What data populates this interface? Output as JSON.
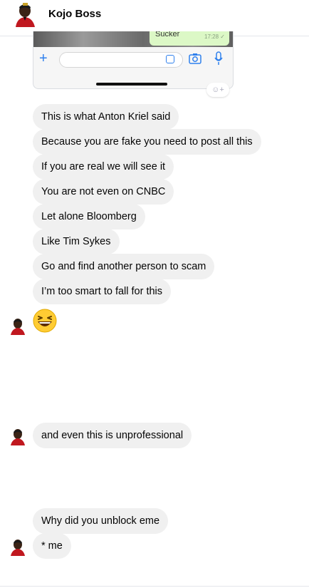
{
  "header": {
    "contact_name": "Kojo Boss"
  },
  "embedded_screenshot": {
    "bubble_text": "Sucker",
    "bubble_time": "17:28 ✓"
  },
  "messages": [
    "This is what Anton Kriel said",
    "Because you are fake you need to post all this",
    "If you are real we will see it",
    "You are not even on CNBC",
    "Let alone Bloomberg",
    "Like Tim Sykes",
    "Go and find another person to scam",
    "I’m too smart to fall for this",
    "and even this is unprofessional",
    "Why did you unblock eme",
    "* me"
  ],
  "icons": {
    "avatar": "avatar-icon",
    "emoji": "grinning-squinting-face-icon",
    "reaction": "add-reaction-icon"
  },
  "colors": {
    "incoming_bubble": "#f0f0f0",
    "text": "#050505",
    "accent": "#2f80ed"
  }
}
